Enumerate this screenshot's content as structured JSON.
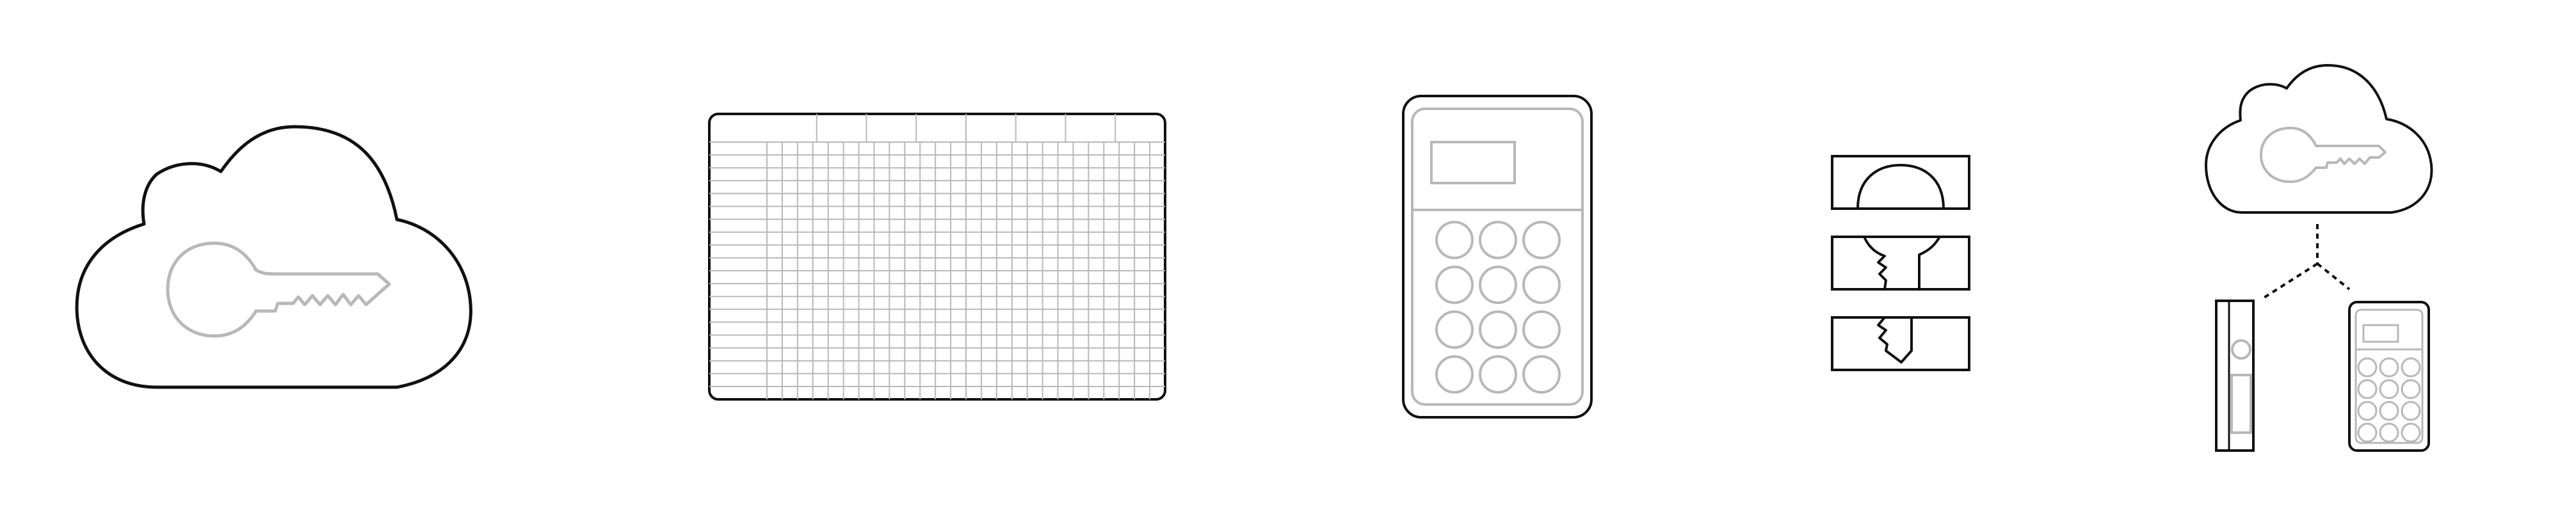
{
  "colors": {
    "background": "#ffffff",
    "outline": "#111111",
    "detail": "#b8b8b8"
  },
  "icons": [
    "cloud-key-icon",
    "grid-card-icon",
    "hardware-keypad-device-icon",
    "split-key-shares-icon",
    "cloud-to-devices-backup-icon"
  ]
}
